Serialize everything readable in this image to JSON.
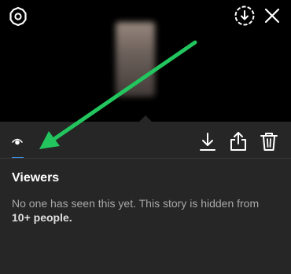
{
  "story": {
    "icons": {
      "settings": "gear-icon",
      "save": "download-circle-icon",
      "close": "close-icon"
    }
  },
  "sheet": {
    "tab_icon": "eye-icon",
    "actions": [
      "download-icon",
      "share-icon",
      "trash-icon"
    ],
    "viewers_title": "Viewers",
    "viewers_message": "No one has seen this yet. This story is hidden from",
    "viewers_message_bold": "10+ people."
  },
  "annotation": {
    "arrow_color": "#22c55e"
  },
  "colors": {
    "sheet_bg": "#262626",
    "accent": "#3897f0"
  }
}
